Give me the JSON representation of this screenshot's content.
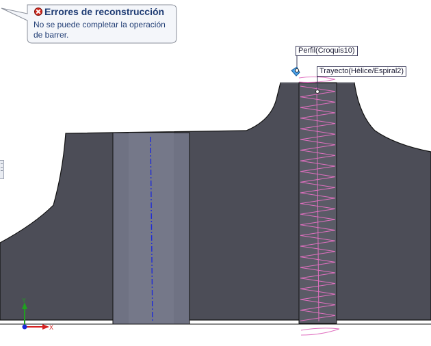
{
  "error_tooltip": {
    "icon": "error-icon",
    "title": "Errores de reconstrucción",
    "message": "No se puede completar la operación de barrer."
  },
  "callouts": {
    "profile": "Perfil(Croquis10)",
    "path": "Trayecto(Hélice/Espiral2)"
  },
  "axes": {
    "y_label": "Y",
    "x_label": "X"
  },
  "colors": {
    "viewport_bg": "#ffffff",
    "part_body": "#4c4d57",
    "part_edge": "#111111",
    "bore_face": "#6f7283",
    "slot_face": "#5a5b66",
    "centerline": "#1e2bd8",
    "helix": "#e070c0",
    "tooltip_border": "#8a8f9a",
    "profile_point": "#4aa0e8",
    "axis_x": "#d62020",
    "axis_y": "#20a020",
    "axis_z": "#1e2bd8"
  }
}
